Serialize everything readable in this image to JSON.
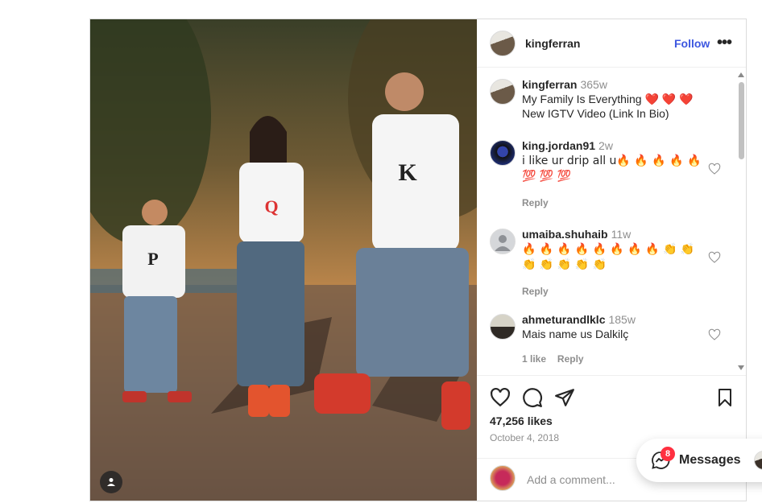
{
  "post": {
    "author": "kingferran",
    "follow_label": "Follow",
    "more_label": "•••",
    "caption_author": "kingferran",
    "caption_time": "365w",
    "caption_text": "My Family Is Everything ❤️ ❤️ ❤️ New IGTV Video (Link In Bio)"
  },
  "comments": [
    {
      "user": "king.jordan91",
      "time": "2w",
      "text": "i like ur drip all u🔥 🔥 🔥 🔥 🔥 💯 💯 💯",
      "reply_label": "Reply",
      "likes_label": ""
    },
    {
      "user": "umaiba.shuhaib",
      "time": "11w",
      "text": "🔥 🔥 🔥 🔥 🔥 🔥 🔥 🔥 👏 👏 👏 👏 👏 👏 👏",
      "reply_label": "Reply",
      "likes_label": ""
    },
    {
      "user": "ahmeturandlklc",
      "time": "185w",
      "text": "Mais name us Dalkilç",
      "reply_label": "Reply",
      "likes_label": "1 like"
    }
  ],
  "stats": {
    "likes": "47,256 likes",
    "date": "October 4, 2018"
  },
  "add_comment": {
    "placeholder": "Add a comment..."
  },
  "messages": {
    "label": "Messages",
    "badge": "8"
  },
  "colors": {
    "accent": "#3d57e0",
    "badge": "#ff3040",
    "muted": "#8e8e8e"
  }
}
